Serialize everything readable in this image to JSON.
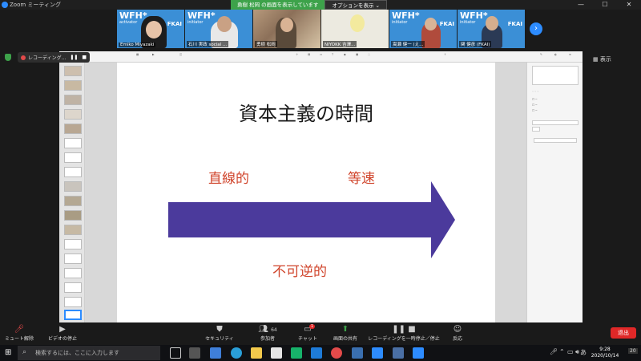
{
  "window": {
    "title": "Zoom ミーティング",
    "share_status": "勇樹 松岡 の画面を表示しています",
    "options_label": "オプションを表示 ⌄"
  },
  "participants": [
    {
      "name": "Emiko Miyazaki",
      "wfh": "WFH*",
      "role": "activator",
      "tag": "FKAI"
    },
    {
      "name": "石川 実政 social ...",
      "wfh": "WFH*",
      "role": "initiator",
      "tag": ""
    },
    {
      "name": "勇樹 松岡",
      "wfh": "",
      "role": "",
      "tag": ""
    },
    {
      "name": "NIYOKK 吉澤...",
      "wfh": "",
      "role": "",
      "tag": ""
    },
    {
      "name": "嵩瀬 健一 (え...",
      "wfh": "WFH*",
      "role": "initiator",
      "tag": "FKAI"
    },
    {
      "name": "関 健彦 (FKAI)",
      "wfh": "WFH*",
      "role": "initiator",
      "tag": "FKAI"
    }
  ],
  "recording": {
    "label": "レコーディング...",
    "pause": "❚❚",
    "stop": "■"
  },
  "view_label": "表示",
  "slide": {
    "title": "資本主義の時間",
    "word_left": "直線的",
    "word_right": "等速",
    "word_bottom": "不可逆的",
    "arrow_color": "#4b3a9c"
  },
  "toolbar": {
    "mute": "ミュート解除",
    "video": "ビデオの停止",
    "security": "セキュリティ",
    "participants": "参加者",
    "participants_count": "64",
    "chat": "チャット",
    "chat_badge": "1",
    "share": "画面の共有",
    "record": "レコーディングを一時停止／停止",
    "reactions": "反応",
    "end": "退出"
  },
  "taskbar": {
    "search_placeholder": "検索するには、ここに入力します",
    "time": "9:28",
    "date": "2020/10/14",
    "ime": "あ",
    "notif": "20"
  }
}
